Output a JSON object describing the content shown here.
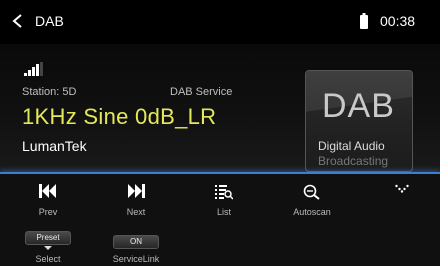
{
  "header": {
    "title": "DAB",
    "time": "00:38"
  },
  "station": {
    "station_label": "Station:  5D",
    "service_label": "DAB Service",
    "track": "1KHz Sine 0dB_LR",
    "artist": "LumanTek"
  },
  "logo": {
    "big": "DAB",
    "line1": "Digital Audio",
    "line2": "Broadcasting"
  },
  "controls": {
    "prev": "Prev",
    "next": "Next",
    "list": "List",
    "autoscan": "Autoscan"
  },
  "bottom": {
    "preset_label": "Preset",
    "select_label": "Select",
    "servicelink_state": "ON",
    "servicelink_label": "ServiceLink"
  },
  "colors": {
    "accent": "#e4e85a",
    "divider": "#3a7fd0"
  }
}
